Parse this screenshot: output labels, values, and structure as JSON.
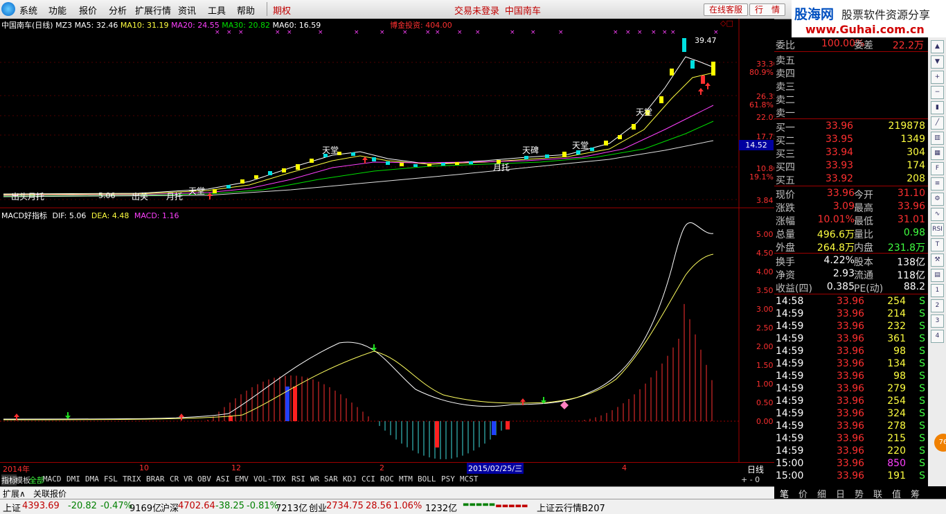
{
  "menu": {
    "items": [
      "系统",
      "功能",
      "报价",
      "分析",
      "扩展行情",
      "资讯",
      "工具",
      "帮助"
    ],
    "futures": "期权",
    "trade_status": "交易未登录",
    "stock_name": "中国南车",
    "online_service": "在线客服",
    "quote_btn": "行　情"
  },
  "logo": {
    "brand": "股海网",
    "slogan": "股票软件资源分享",
    "url": "www.Guhai.com.cn"
  },
  "kline": {
    "title": "中国南车(日线)",
    "ma_label": "MZ3",
    "ma5": "MA5: 32.46",
    "ma10": "MA10: 31.19",
    "ma20": "MA20: 24.55",
    "ma30": "MA30: 20.82",
    "ma60": "MA60: 16.59",
    "gold": "博金投资: 404.00",
    "peak": "39.47",
    "cursor_price": "14.52",
    "labels": [
      "天堂",
      "天堂",
      "天碑",
      "天堂",
      "天堂",
      "月托",
      "出关",
      "月托",
      "出关",
      "天堂"
    ],
    "bottom_left": "出头月托",
    "bottom_mid": "5.06",
    "price_ticks": [
      "33.30",
      "80.9%",
      "26.35",
      "61.8%",
      "22.05",
      "17.75",
      "10.80",
      "19.1%",
      "3.84"
    ],
    "colors": {
      "ma5": "#ffffff",
      "ma10": "#ffff40",
      "ma20": "#ff40ff",
      "ma30": "#00e000",
      "ma60": "#e0e0e0"
    }
  },
  "macd": {
    "title": "MACD好指标",
    "dif": "DIF: 5.06",
    "dea": "DEA: 4.48",
    "macd": "MACD: 1.16",
    "ticks": [
      "5.00",
      "4.50",
      "4.00",
      "3.50",
      "3.00",
      "2.50",
      "2.00",
      "1.50",
      "1.00",
      "0.50",
      "0.00"
    ]
  },
  "dates": {
    "year": "2014年",
    "m10": "10",
    "m12": "12",
    "m2": "2",
    "cursor": "2015/02/25/三",
    "m4": "4",
    "period": "日线"
  },
  "indicator_tabs": [
    "指标",
    "模板",
    "全部",
    "MACD",
    "DMI",
    "DMA",
    "FSL",
    "TRIX",
    "BRAR",
    "CR",
    "VR",
    "OBV",
    "ASI",
    "EMV",
    "VOL-TDX",
    "RSI",
    "WR",
    "SAR",
    "KDJ",
    "CCI",
    "ROC",
    "MTM",
    "BOLL",
    "PSY",
    "MCST"
  ],
  "ext_tabs": [
    "扩展∧",
    "关联报价"
  ],
  "quote": {
    "weibi_label": "委比",
    "weibi": "100.00%",
    "weicha_label": "委差",
    "weicha": "22.2万",
    "asks": [
      "卖五",
      "卖四",
      "卖三",
      "卖二",
      "卖一"
    ],
    "bids": [
      {
        "label": "买一",
        "price": "33.96",
        "vol": "219878"
      },
      {
        "label": "买二",
        "price": "33.95",
        "vol": "1349"
      },
      {
        "label": "买三",
        "price": "33.94",
        "vol": "304"
      },
      {
        "label": "买四",
        "price": "33.93",
        "vol": "174"
      },
      {
        "label": "买五",
        "price": "33.92",
        "vol": "208"
      }
    ],
    "stats": [
      {
        "l1": "现价",
        "v1": "33.96",
        "l2": "今开",
        "v2": "31.10"
      },
      {
        "l1": "涨跌",
        "v1": "3.09",
        "l2": "最高",
        "v2": "33.96"
      },
      {
        "l1": "涨幅",
        "v1": "10.01%",
        "l2": "最低",
        "v2": "31.01"
      },
      {
        "l1": "总量",
        "v1": "496.6万",
        "l2": "量比",
        "v2": "0.98"
      },
      {
        "l1": "外盘",
        "v1": "264.8万",
        "l2": "内盘",
        "v2": "231.8万"
      }
    ],
    "fin": [
      {
        "l1": "换手",
        "v1": "4.22%",
        "l2": "股本",
        "v2": "138亿"
      },
      {
        "l1": "净资",
        "v1": "2.93",
        "l2": "流通",
        "v2": "118亿"
      },
      {
        "l1": "收益(四)",
        "v1": "0.385",
        "l2": "PE(动)",
        "v2": "88.2"
      }
    ],
    "ticks": [
      {
        "t": "14:58",
        "p": "33.96",
        "v": "254",
        "s": "S"
      },
      {
        "t": "14:59",
        "p": "33.96",
        "v": "214",
        "s": "S"
      },
      {
        "t": "14:59",
        "p": "33.96",
        "v": "232",
        "s": "S"
      },
      {
        "t": "14:59",
        "p": "33.96",
        "v": "361",
        "s": "S"
      },
      {
        "t": "14:59",
        "p": "33.96",
        "v": "98",
        "s": "S"
      },
      {
        "t": "14:59",
        "p": "33.96",
        "v": "134",
        "s": "S"
      },
      {
        "t": "14:59",
        "p": "33.96",
        "v": "98",
        "s": "S"
      },
      {
        "t": "14:59",
        "p": "33.96",
        "v": "279",
        "s": "S"
      },
      {
        "t": "14:59",
        "p": "33.96",
        "v": "254",
        "s": "S"
      },
      {
        "t": "14:59",
        "p": "33.96",
        "v": "324",
        "s": "S"
      },
      {
        "t": "14:59",
        "p": "33.96",
        "v": "278",
        "s": "S"
      },
      {
        "t": "14:59",
        "p": "33.96",
        "v": "215",
        "s": "S"
      },
      {
        "t": "14:59",
        "p": "33.96",
        "v": "220",
        "s": "S"
      },
      {
        "t": "15:00",
        "p": "33.96",
        "v": "850",
        "s": "S"
      },
      {
        "t": "15:00",
        "p": "33.96",
        "v": "191",
        "s": "S"
      }
    ],
    "bottom_tabs": [
      "笔",
      "价",
      "细",
      "日",
      "势",
      "联",
      "值",
      "筹"
    ]
  },
  "status": {
    "sh_label": "上证",
    "sh": "4393.69",
    "sh_chg": "-20.82",
    "sh_pct": "-0.47%",
    "sh_amt": "9169亿",
    "sz_label": "沪深",
    "sz": "4702.64",
    "sz_chg": "-38.25",
    "sz_pct": "-0.81%",
    "sz_amt": "7213亿",
    "cy_label": "创业",
    "cy": "2734.75",
    "cy_chg": "28.56",
    "cy_pct": "1.06%",
    "cy_amt": "1232亿",
    "cloud": "上证云行情B207"
  },
  "toolbar_icons": [
    "arrow-up-icon",
    "arrow-down-icon",
    "zoom-in-icon",
    "zoom-out-icon",
    "kline-icon",
    "line-icon",
    "bar-icon",
    "grid-icon",
    "f10-icon",
    "list-icon",
    "settings-icon",
    "chart-icon",
    "rsi-icon",
    "text-icon",
    "tool-icon",
    "doc-icon",
    "num-1",
    "num-2",
    "num-3",
    "num-4"
  ]
}
